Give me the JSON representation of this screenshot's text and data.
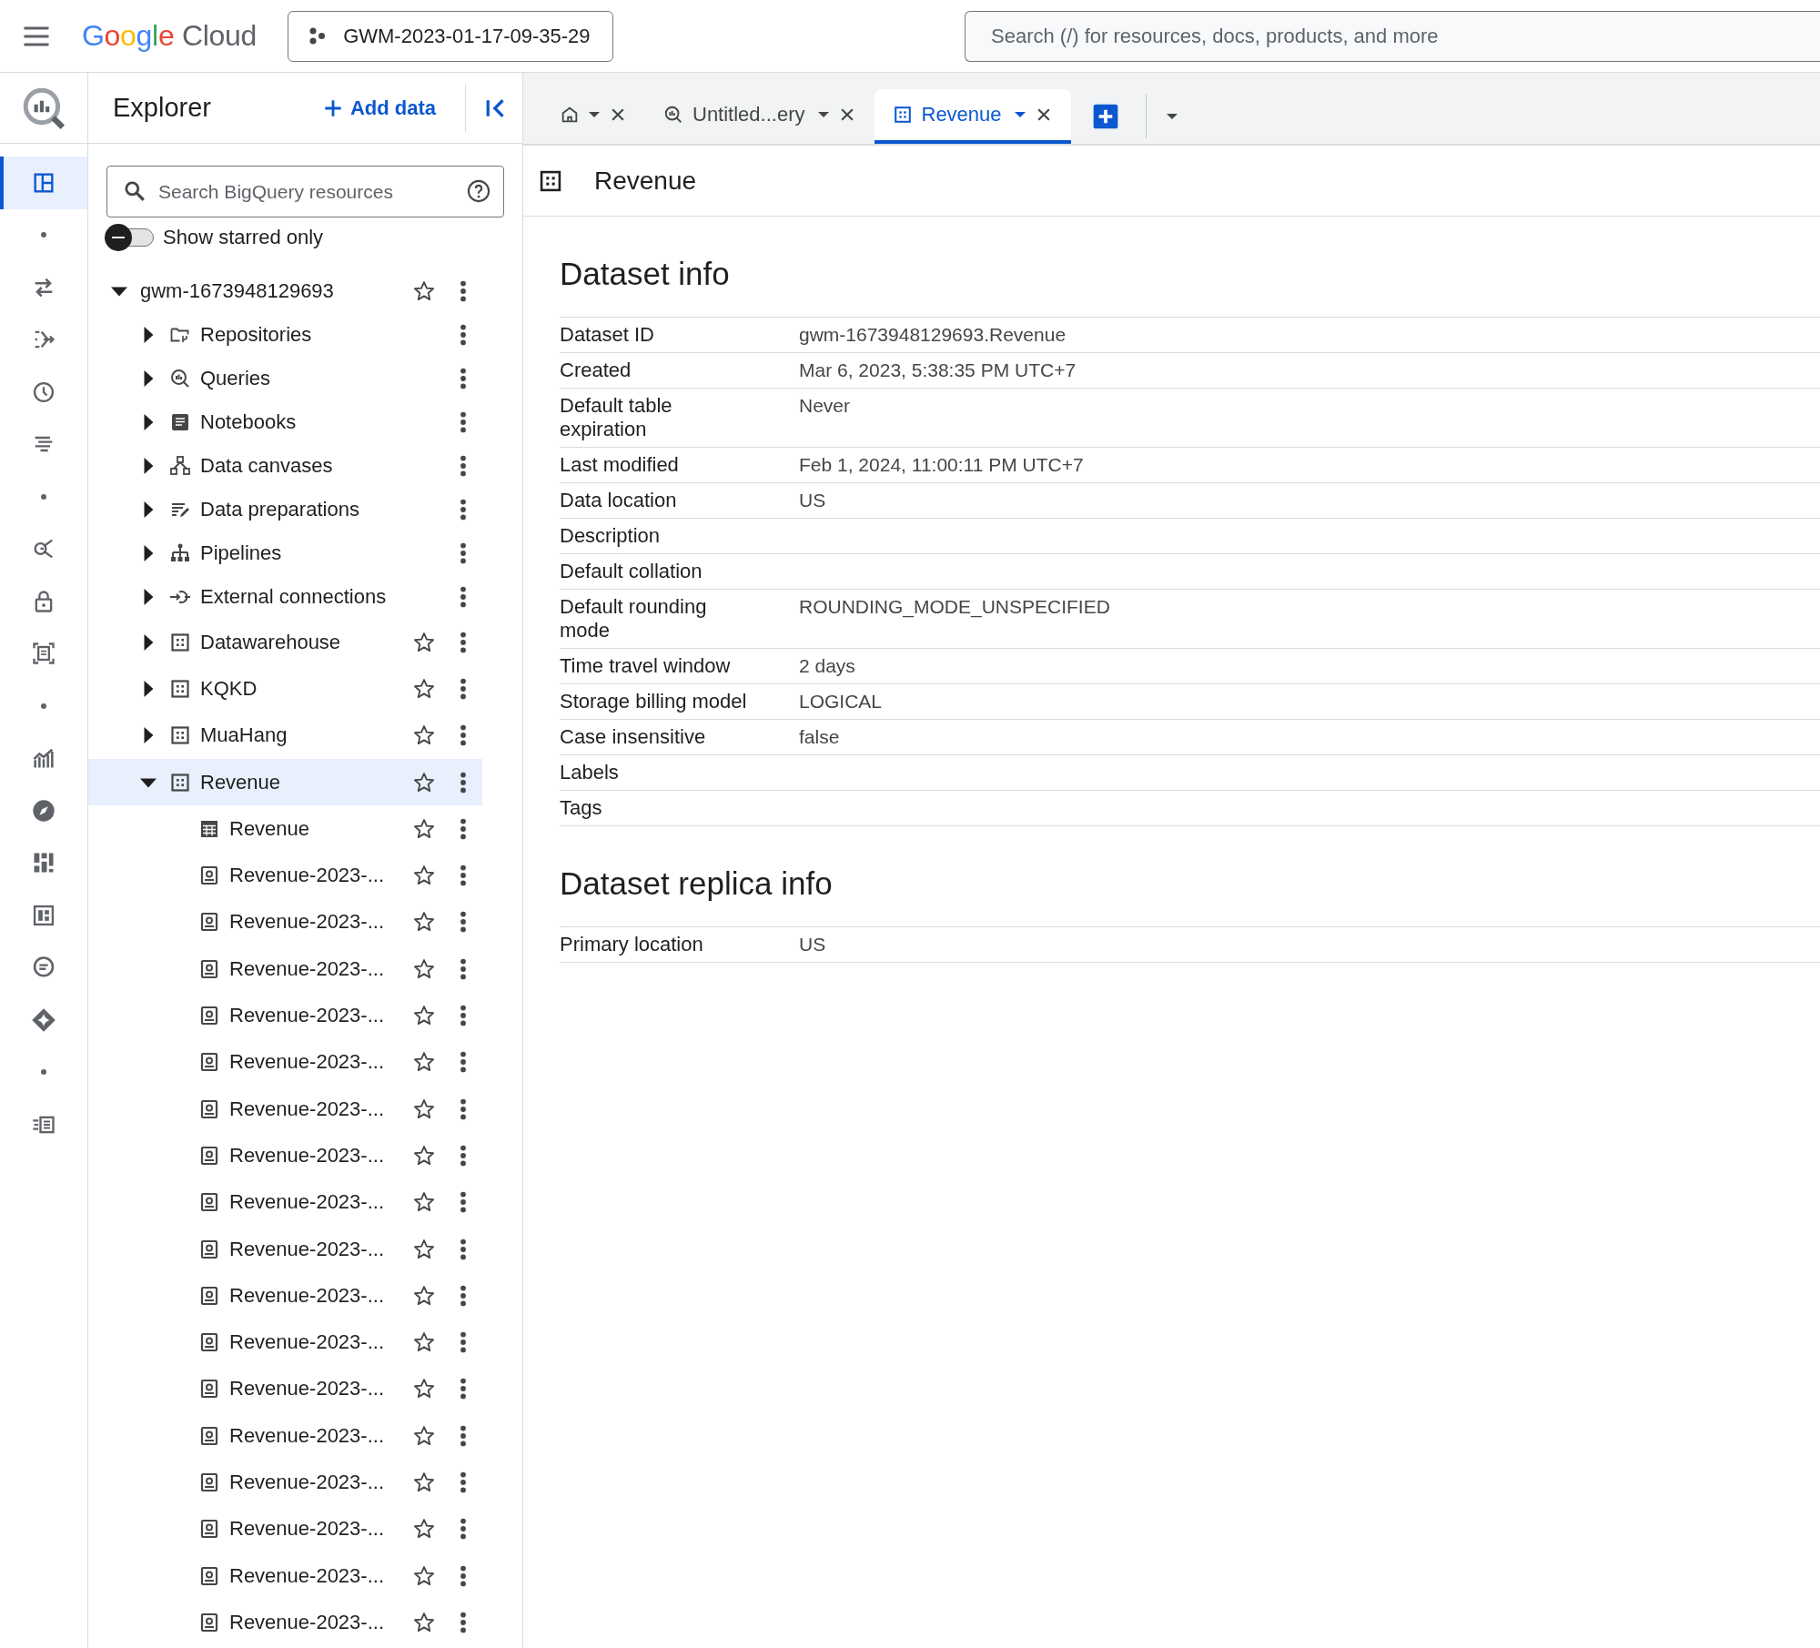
{
  "topbar": {
    "logo": {
      "brand": "Google",
      "product": "Cloud"
    },
    "project": "GWM-2023-01-17-09-35-29",
    "search": {
      "placeholder": "Search (/) for resources, docs, products, and more"
    }
  },
  "rail": [
    {
      "kind": "item",
      "selected": true
    },
    {
      "kind": "dot"
    },
    {
      "kind": "item",
      "selected": false
    },
    {
      "kind": "item",
      "selected": false
    },
    {
      "kind": "item",
      "selected": false
    },
    {
      "kind": "item",
      "selected": false
    },
    {
      "kind": "dot"
    },
    {
      "kind": "item",
      "selected": false
    },
    {
      "kind": "item",
      "selected": false
    },
    {
      "kind": "item",
      "selected": false
    },
    {
      "kind": "dot"
    },
    {
      "kind": "item",
      "selected": false
    },
    {
      "kind": "item",
      "selected": false
    },
    {
      "kind": "item",
      "selected": false
    },
    {
      "kind": "item",
      "selected": false
    },
    {
      "kind": "item",
      "selected": false
    },
    {
      "kind": "item",
      "selected": false
    },
    {
      "kind": "dot"
    },
    {
      "kind": "item",
      "selected": false
    }
  ],
  "explorer": {
    "title": "Explorer",
    "add_button": "Add data",
    "search": {
      "placeholder": "Search BigQuery resources"
    },
    "starred_toggle": {
      "label": "Show starred only",
      "on": false
    },
    "tree": [
      {
        "label": "gwm-1673948129693",
        "kind": "project",
        "expanded": true,
        "starred": false,
        "selected": false,
        "children": [
          {
            "label": "Repositories",
            "kind": "repositories",
            "expanded": false,
            "selected": false
          },
          {
            "label": "Queries",
            "kind": "queries",
            "expanded": false,
            "selected": false
          },
          {
            "label": "Notebooks",
            "kind": "notebooks",
            "expanded": false,
            "selected": false
          },
          {
            "label": "Data canvases",
            "kind": "canvases",
            "expanded": false,
            "selected": false
          },
          {
            "label": "Data preparations",
            "kind": "preparations",
            "expanded": false,
            "selected": false
          },
          {
            "label": "Pipelines",
            "kind": "pipelines",
            "expanded": false,
            "selected": false
          },
          {
            "label": "External connections",
            "kind": "connections",
            "expanded": false,
            "selected": false
          },
          {
            "label": "Datawarehouse",
            "kind": "dataset",
            "expanded": false,
            "starred": false,
            "selected": false
          },
          {
            "label": "KQKD",
            "kind": "dataset",
            "expanded": false,
            "starred": false,
            "selected": false
          },
          {
            "label": "MuaHang",
            "kind": "dataset",
            "expanded": false,
            "starred": false,
            "selected": false
          },
          {
            "label": "Revenue",
            "kind": "dataset",
            "expanded": true,
            "starred": false,
            "selected": true,
            "children": [
              {
                "label": "Revenue",
                "kind": "table",
                "starred": false,
                "selected": false
              },
              {
                "label": "Revenue-2023-...",
                "kind": "snapshot",
                "starred": false,
                "selected": false
              },
              {
                "label": "Revenue-2023-...",
                "kind": "snapshot",
                "starred": false,
                "selected": false
              },
              {
                "label": "Revenue-2023-...",
                "kind": "snapshot",
                "starred": false,
                "selected": false
              },
              {
                "label": "Revenue-2023-...",
                "kind": "snapshot",
                "starred": false,
                "selected": false
              },
              {
                "label": "Revenue-2023-...",
                "kind": "snapshot",
                "starred": false,
                "selected": false
              },
              {
                "label": "Revenue-2023-...",
                "kind": "snapshot",
                "starred": false,
                "selected": false
              },
              {
                "label": "Revenue-2023-...",
                "kind": "snapshot",
                "starred": false,
                "selected": false
              },
              {
                "label": "Revenue-2023-...",
                "kind": "snapshot",
                "starred": false,
                "selected": false
              },
              {
                "label": "Revenue-2023-...",
                "kind": "snapshot",
                "starred": false,
                "selected": false
              },
              {
                "label": "Revenue-2023-...",
                "kind": "snapshot",
                "starred": false,
                "selected": false
              },
              {
                "label": "Revenue-2023-...",
                "kind": "snapshot",
                "starred": false,
                "selected": false
              },
              {
                "label": "Revenue-2023-...",
                "kind": "snapshot",
                "starred": false,
                "selected": false
              },
              {
                "label": "Revenue-2023-...",
                "kind": "snapshot",
                "starred": false,
                "selected": false
              },
              {
                "label": "Revenue-2023-...",
                "kind": "snapshot",
                "starred": false,
                "selected": false
              },
              {
                "label": "Revenue-2023-...",
                "kind": "snapshot",
                "starred": false,
                "selected": false
              },
              {
                "label": "Revenue-2023-...",
                "kind": "snapshot",
                "starred": false,
                "selected": false
              },
              {
                "label": "Revenue-2023-...",
                "kind": "snapshot",
                "starred": false,
                "selected": false
              }
            ]
          }
        ]
      }
    ]
  },
  "tabs": [
    {
      "kind": "home",
      "selected": false
    },
    {
      "kind": "query",
      "label": "Untitled...ery",
      "selected": false
    },
    {
      "kind": "dataset",
      "label": "Revenue",
      "selected": true
    }
  ],
  "panel": {
    "title": "Revenue",
    "sections": [
      {
        "title": "Dataset info",
        "rows": [
          {
            "label": "Dataset ID",
            "value": "gwm-1673948129693.Revenue"
          },
          {
            "label": "Created",
            "value": "Mar 6, 2023, 5:38:35 PM UTC+7"
          },
          {
            "label": "Default table expiration",
            "value": "Never"
          },
          {
            "label": "Last modified",
            "value": "Feb 1, 2024, 11:00:11 PM UTC+7"
          },
          {
            "label": "Data location",
            "value": "US"
          },
          {
            "label": "Description"
          },
          {
            "label": "Default collation"
          },
          {
            "label": "Default rounding mode",
            "value": "ROUNDING_MODE_UNSPECIFIED"
          },
          {
            "label": "Time travel window",
            "value": "2 days"
          },
          {
            "label": "Storage billing model",
            "value": "LOGICAL"
          },
          {
            "label": "Case insensitive",
            "value": "false"
          },
          {
            "label": "Labels"
          },
          {
            "label": "Tags"
          }
        ]
      },
      {
        "title": "Dataset replica info",
        "rows": [
          {
            "label": "Primary location",
            "value": "US"
          }
        ]
      }
    ]
  }
}
